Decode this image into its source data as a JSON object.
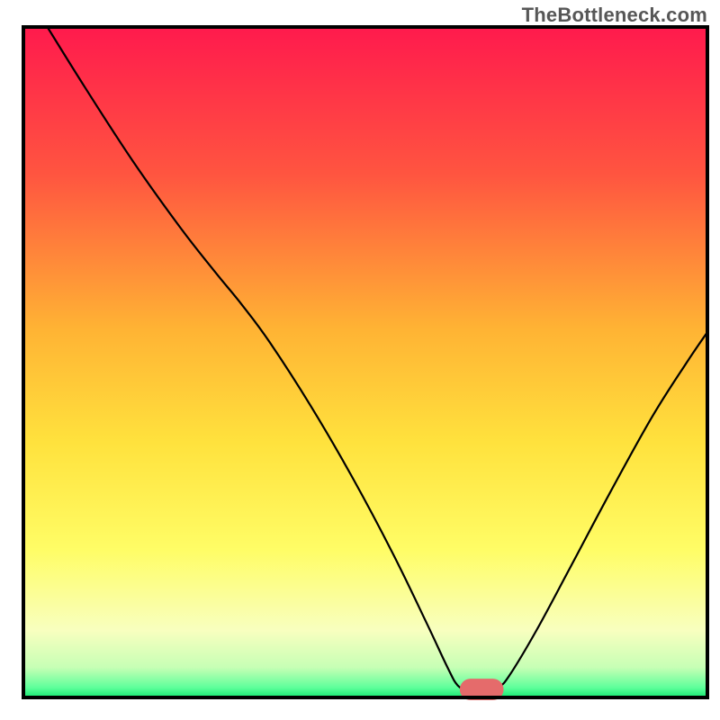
{
  "watermark": "TheBottleneck.com",
  "chart_data": {
    "type": "line",
    "title": "",
    "xlabel": "",
    "ylabel": "",
    "xlim": [
      0,
      100
    ],
    "ylim": [
      0,
      100
    ],
    "background": {
      "type": "vertical-gradient",
      "stops": [
        {
          "offset": 0.0,
          "color": "#ff1a4d"
        },
        {
          "offset": 0.22,
          "color": "#ff5540"
        },
        {
          "offset": 0.45,
          "color": "#ffb334"
        },
        {
          "offset": 0.62,
          "color": "#ffe23d"
        },
        {
          "offset": 0.78,
          "color": "#fffd66"
        },
        {
          "offset": 0.9,
          "color": "#f8ffbf"
        },
        {
          "offset": 0.955,
          "color": "#c7ffb5"
        },
        {
          "offset": 0.985,
          "color": "#5fff9b"
        },
        {
          "offset": 1.0,
          "color": "#16e872"
        }
      ]
    },
    "axes": {
      "show_ticks": false,
      "frame_color": "#000000",
      "frame_width": 4
    },
    "marker": {
      "x": 67,
      "y": 1.2,
      "color": "#e56b6b",
      "rx": 3.2,
      "ry": 1.6
    },
    "series": [
      {
        "name": "bottleneck-curve",
        "color": "#000000",
        "width": 2.2,
        "points": [
          {
            "x": 3.5,
            "y": 100.0
          },
          {
            "x": 9.0,
            "y": 91.0
          },
          {
            "x": 16.0,
            "y": 80.0
          },
          {
            "x": 23.0,
            "y": 70.0
          },
          {
            "x": 28.0,
            "y": 63.5
          },
          {
            "x": 32.0,
            "y": 58.5
          },
          {
            "x": 36.0,
            "y": 53.0
          },
          {
            "x": 42.0,
            "y": 43.5
          },
          {
            "x": 48.0,
            "y": 33.0
          },
          {
            "x": 54.0,
            "y": 21.5
          },
          {
            "x": 59.0,
            "y": 11.0
          },
          {
            "x": 62.0,
            "y": 4.5
          },
          {
            "x": 63.5,
            "y": 1.8
          },
          {
            "x": 65.0,
            "y": 1.2
          },
          {
            "x": 68.0,
            "y": 1.2
          },
          {
            "x": 69.5,
            "y": 1.6
          },
          {
            "x": 71.0,
            "y": 3.2
          },
          {
            "x": 75.0,
            "y": 10.0
          },
          {
            "x": 80.0,
            "y": 19.5
          },
          {
            "x": 86.0,
            "y": 31.0
          },
          {
            "x": 92.0,
            "y": 42.0
          },
          {
            "x": 97.0,
            "y": 50.0
          },
          {
            "x": 100.0,
            "y": 54.5
          }
        ]
      }
    ]
  }
}
